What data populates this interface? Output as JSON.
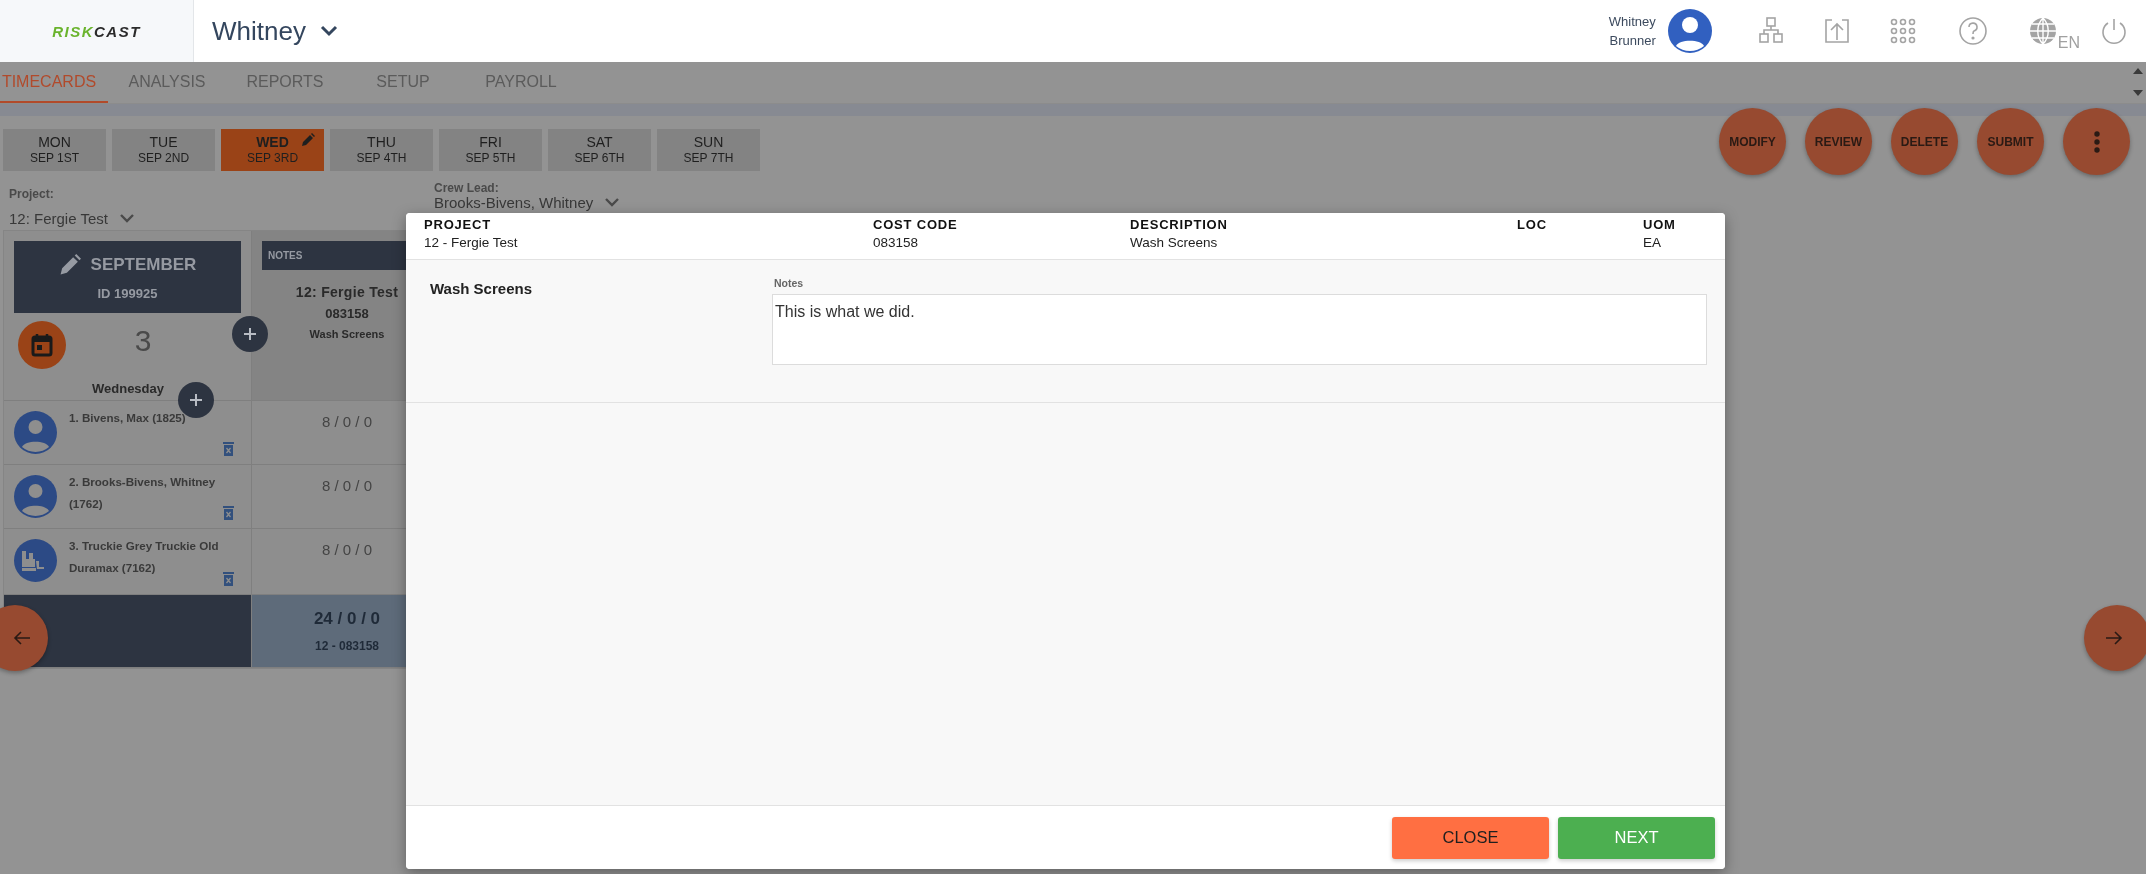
{
  "header": {
    "logo_first": "RISK",
    "logo_second": "CAST",
    "crew": "Whitney",
    "user_name": "Whitney Brunner",
    "language": "EN"
  },
  "tabs": [
    {
      "label": "TIMECARDS",
      "selected": true
    },
    {
      "label": "ANALYSIS",
      "selected": false
    },
    {
      "label": "REPORTS",
      "selected": false
    },
    {
      "label": "SETUP",
      "selected": false
    },
    {
      "label": "PAYROLL",
      "selected": false
    }
  ],
  "days": [
    {
      "day": "MON",
      "date": "SEP 1ST",
      "selected": false
    },
    {
      "day": "TUE",
      "date": "SEP 2ND",
      "selected": false
    },
    {
      "day": "WED",
      "date": "SEP 3RD",
      "selected": true
    },
    {
      "day": "THU",
      "date": "SEP 4TH",
      "selected": false
    },
    {
      "day": "FRI",
      "date": "SEP 5TH",
      "selected": false
    },
    {
      "day": "SAT",
      "date": "SEP 6TH",
      "selected": false
    },
    {
      "day": "SUN",
      "date": "SEP 7TH",
      "selected": false
    }
  ],
  "actions": [
    "MODIFY",
    "REVIEW",
    "DELETE",
    "SUBMIT"
  ],
  "project": {
    "label": "Project:",
    "value": "12: Fergie Test"
  },
  "crew_lead": {
    "label": "Crew Lead:",
    "value": "Brooks-Bivens, Whitney"
  },
  "timecard": {
    "month": "SEPTEMBER",
    "id": "ID 199925",
    "day_number": "3",
    "weekday": "Wednesday",
    "notes_header": "NOTES",
    "job": {
      "project": "12: Fergie Test",
      "cost_code": "083158",
      "description": "Wash Screens"
    },
    "members": [
      {
        "name": "1. Bivens, Max (1825)",
        "kind": "person",
        "hours": "8 / 0 / 0"
      },
      {
        "name": "2. Brooks-Bivens, Whitney (1762)",
        "kind": "person",
        "hours": "8 / 0 / 0"
      },
      {
        "name": "3. Truckie Grey Truckie Old Duramax (7162)",
        "kind": "equipment",
        "hours": "8 / 0 / 0"
      }
    ],
    "total": "24 / 0 / 0",
    "total_code": "12 - 083158"
  },
  "dialog": {
    "columns": [
      {
        "heading": "PROJECT",
        "value": "12 - Fergie Test"
      },
      {
        "heading": "COST CODE",
        "value": "083158"
      },
      {
        "heading": "DESCRIPTION",
        "value": "Wash Screens"
      },
      {
        "heading": "LOC"
      },
      {
        "heading": "UOM",
        "value": "EA"
      }
    ],
    "item": "Wash Screens",
    "notes_label": "Notes",
    "notes_value": "This is what we did.",
    "buttons": [
      {
        "label": "CLOSE",
        "kind": "secondary"
      },
      {
        "label": "NEXT",
        "kind": "primary"
      }
    ]
  }
}
